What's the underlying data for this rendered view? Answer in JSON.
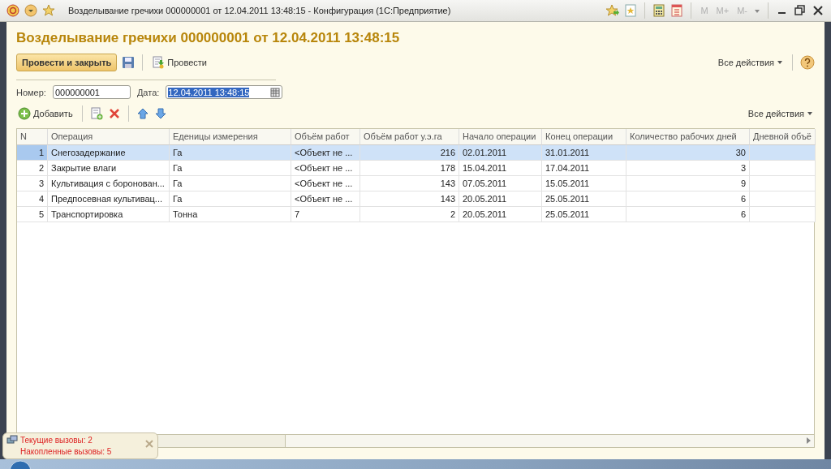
{
  "window": {
    "title": "Возделывание гречихи 000000001 от 12.04.2011 13:48:15 - Конфигурация  (1С:Предприятие)",
    "memory_buttons": [
      "M",
      "M+",
      "M-"
    ]
  },
  "document": {
    "heading": "Возделывание гречихи 000000001 от 12.04.2011 13:48:15",
    "commands": {
      "primary": "Провести и закрыть",
      "post": "Провести",
      "all_actions": "Все действия"
    },
    "fields": [
      {
        "label": "Номер:",
        "value": "000000001",
        "text_selected": false,
        "kind": "text"
      },
      {
        "label": "Дата:",
        "value": "12.04.2011 13:48:15",
        "text_selected": true,
        "kind": "date"
      }
    ]
  },
  "table_toolbar": {
    "add": "Добавить",
    "all_actions": "Все действия"
  },
  "table": {
    "columns": [
      {
        "label": "N",
        "kind": "number"
      },
      {
        "label": "Операция",
        "kind": "text"
      },
      {
        "label": "Еденицы измерения",
        "kind": "text"
      },
      {
        "label": "Объём работ",
        "kind": "text"
      },
      {
        "label": "Объём работ у.э.га",
        "kind": "number"
      },
      {
        "label": "Начало операции",
        "kind": "text"
      },
      {
        "label": "Конец операции",
        "kind": "text"
      },
      {
        "label": "Количество рабочих дней",
        "kind": "number"
      },
      {
        "label": "Дневной объё",
        "kind": "text"
      }
    ],
    "rows": [
      {
        "selected": true,
        "cells": [
          "1",
          "Снегозадержание",
          "Га",
          "<Объект не ...",
          "216",
          "02.01.2011",
          "31.01.2011",
          "30"
        ]
      },
      {
        "selected": false,
        "cells": [
          "2",
          "Закрытие влаги",
          "Га",
          "<Объект не ...",
          "178",
          "15.04.2011",
          "17.04.2011",
          "3"
        ]
      },
      {
        "selected": false,
        "cells": [
          "3",
          "Культивация с боронован...",
          "Га",
          "<Объект не ...",
          "143",
          "07.05.2011",
          "15.05.2011",
          "9"
        ]
      },
      {
        "selected": false,
        "cells": [
          "4",
          "Предпосевная культивац...",
          "Га",
          "<Объект не ...",
          "143",
          "20.05.2011",
          "25.05.2011",
          "6"
        ]
      },
      {
        "selected": false,
        "cells": [
          "5",
          "Транспортировка",
          "Тонна",
          "7",
          "2",
          "20.05.2011",
          "25.05.2011",
          "6"
        ]
      }
    ]
  },
  "status_popup": {
    "lines": [
      "Текущие вызовы: 2",
      "Накопленные вызовы: 5"
    ]
  }
}
